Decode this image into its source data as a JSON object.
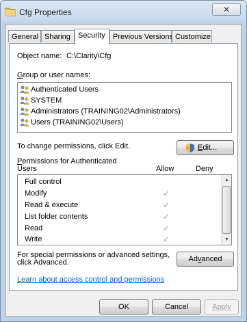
{
  "window": {
    "title": "Cfg Properties",
    "close_glyph": "✕"
  },
  "tabs": [
    {
      "label": "General"
    },
    {
      "label": "Sharing"
    },
    {
      "label": "Security",
      "active": true
    },
    {
      "label": "Previous Versions"
    },
    {
      "label": "Customize"
    }
  ],
  "security": {
    "object_name_label": "Object name:",
    "object_name_value": "C:\\Clarity\\Cfg",
    "group_label": "Group or user names:",
    "users": [
      {
        "name": "Authenticated Users",
        "icon": "users-group-icon"
      },
      {
        "name": "SYSTEM",
        "icon": "users-group-icon"
      },
      {
        "name": "Administrators (TRAINING02\\Administrators)",
        "icon": "users-group-icon"
      },
      {
        "name": "Users (TRAINING02\\Users)",
        "icon": "users-group-icon"
      }
    ],
    "change_text": "To change permissions, click Edit.",
    "edit_button": "Edit...",
    "permissions_for_line1": "Permissions for Authenticated",
    "permissions_for_line2": "Users",
    "allow_header": "Allow",
    "deny_header": "Deny",
    "permissions": [
      {
        "name": "Full control",
        "allow": false,
        "deny": false
      },
      {
        "name": "Modify",
        "allow": true,
        "deny": false
      },
      {
        "name": "Read & execute",
        "allow": true,
        "deny": false
      },
      {
        "name": "List folder contents",
        "allow": true,
        "deny": false
      },
      {
        "name": "Read",
        "allow": true,
        "deny": false
      },
      {
        "name": "Write",
        "allow": true,
        "deny": false
      }
    ],
    "special_text_line1": "For special permissions or advanced settings,",
    "special_text_line2": "click Advanced.",
    "advanced_button": "Advanced",
    "learn_link": "Learn about access control and permissions"
  },
  "footer": {
    "ok": "OK",
    "cancel": "Cancel",
    "apply": "Apply"
  },
  "colors": {
    "link": "#0066cc",
    "check_mark": "#9aa2aa",
    "titlebar": "#cbdbed"
  }
}
